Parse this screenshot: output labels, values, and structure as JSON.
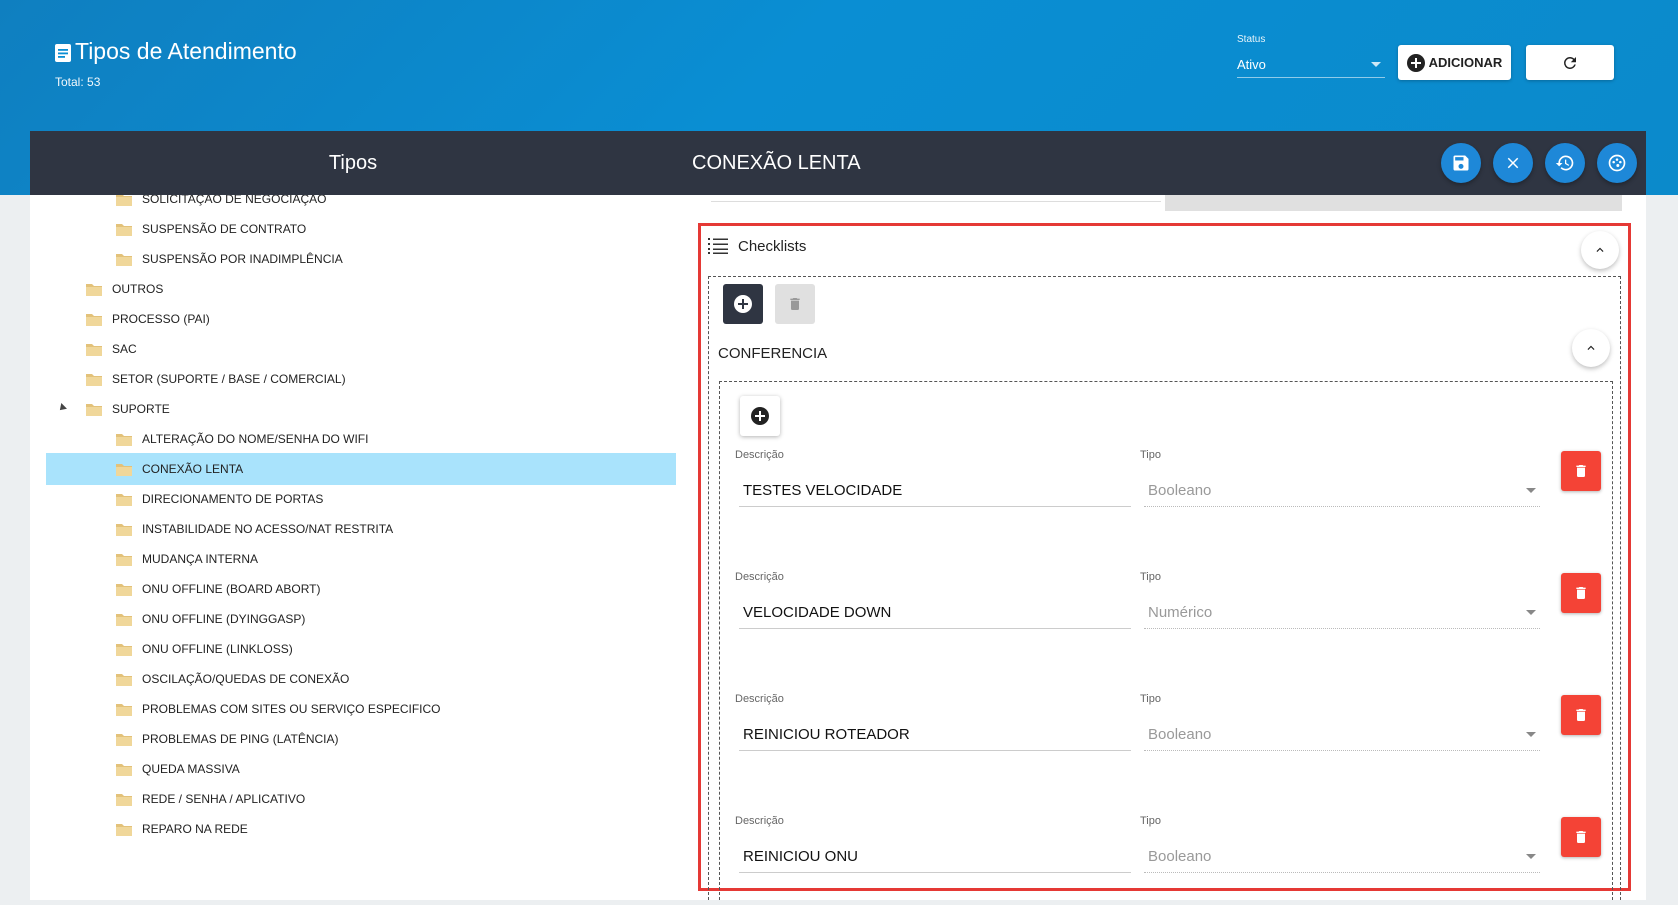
{
  "header": {
    "title": "Tipos de Atendimento",
    "subtitle": "Total: 53",
    "status_label": "Status",
    "status_value": "Ativo",
    "add_label": "ADICIONAR"
  },
  "left_panel": {
    "title": "Tipos",
    "tree": [
      {
        "label": "SOLICITAÇÃO DE NEGOCIAÇÃO",
        "level": 2
      },
      {
        "label": "SUSPENSÃO DE CONTRATO",
        "level": 2
      },
      {
        "label": "SUSPENSÃO POR INADIMPLÊNCIA",
        "level": 2
      },
      {
        "label": "OUTROS",
        "level": 1
      },
      {
        "label": "PROCESSO (PAI)",
        "level": 1
      },
      {
        "label": "SAC",
        "level": 1
      },
      {
        "label": "SETOR (SUPORTE / BASE / COMERCIAL)",
        "level": 1
      },
      {
        "label": "SUPORTE",
        "level": 1,
        "expanded": true
      },
      {
        "label": "ALTERAÇÃO DO NOME/SENHA DO WIFI",
        "level": 2
      },
      {
        "label": "CONEXÃO LENTA",
        "level": 2,
        "selected": true
      },
      {
        "label": "DIRECIONAMENTO DE PORTAS",
        "level": 2
      },
      {
        "label": "INSTABILIDADE NO ACESSO/NAT RESTRITA",
        "level": 2
      },
      {
        "label": "MUDANÇA INTERNA",
        "level": 2
      },
      {
        "label": "ONU OFFLINE (BOARD ABORT)",
        "level": 2
      },
      {
        "label": "ONU OFFLINE (DYINGGASP)",
        "level": 2
      },
      {
        "label": "ONU OFFLINE (LINKLOSS)",
        "level": 2
      },
      {
        "label": "OSCILAÇÃO/QUEDAS DE CONEXÃO",
        "level": 2
      },
      {
        "label": "PROBLEMAS COM SITES OU SERVIÇO ESPECIFICO",
        "level": 2
      },
      {
        "label": "PROBLEMAS DE PING (LATÊNCIA)",
        "level": 2
      },
      {
        "label": "QUEDA MASSIVA",
        "level": 2
      },
      {
        "label": "REDE / SENHA / APLICATIVO",
        "level": 2
      },
      {
        "label": "REPARO NA REDE",
        "level": 2
      }
    ]
  },
  "right_panel": {
    "title": "CONEXÃO LENTA",
    "checklists_label": "Checklists",
    "checklist_name": "CONFERENCIA",
    "items": [
      {
        "desc_label": "Descrição",
        "desc_value": "TESTES VELOCIDADE",
        "type_label": "Tipo",
        "type_value": "Booleano"
      },
      {
        "desc_label": "Descrição",
        "desc_value": "VELOCIDADE DOWN",
        "type_label": "Tipo",
        "type_value": "Numérico"
      },
      {
        "desc_label": "Descrição",
        "desc_value": "REINICIOU ROTEADOR",
        "type_label": "Tipo",
        "type_value": "Booleano"
      },
      {
        "desc_label": "Descrição",
        "desc_value": "REINICIOU ONU",
        "type_label": "Tipo",
        "type_value": "Booleano"
      }
    ]
  },
  "colors": {
    "header_blue": "#0a8ed3",
    "dark_bar": "#2f3542",
    "selected_row": "#a9e3fc",
    "action_blue": "#1e88d8",
    "danger_red": "#f44336",
    "highlight_border": "#e53935"
  }
}
